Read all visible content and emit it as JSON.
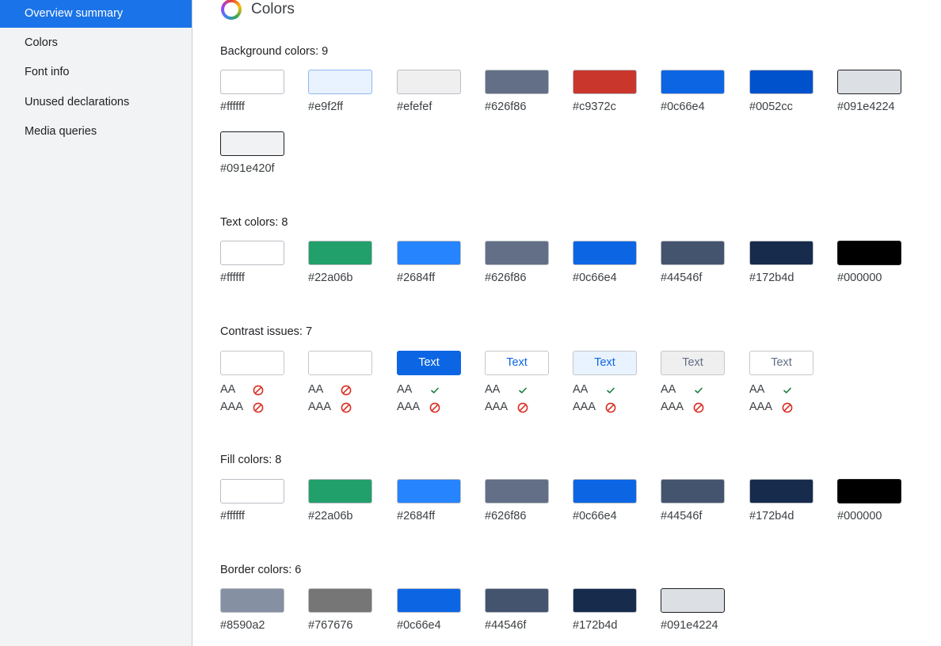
{
  "sidebar": {
    "items": [
      {
        "label": "Overview summary",
        "active": true
      },
      {
        "label": "Colors",
        "active": false
      },
      {
        "label": "Font info",
        "active": false
      },
      {
        "label": "Unused declarations",
        "active": false
      },
      {
        "label": "Media queries",
        "active": false
      }
    ]
  },
  "header": {
    "title": "Colors",
    "icon": "color-wheel-icon"
  },
  "background_colors": {
    "title": "Background colors: 9",
    "items": [
      "#ffffff",
      "#e9f2ff",
      "#efefef",
      "#626f86",
      "#c9372c",
      "#0c66e4",
      "#0052cc",
      "#091e4224",
      "#091e420f"
    ]
  },
  "text_colors": {
    "title": "Text colors: 8",
    "items": [
      "#ffffff",
      "#22a06b",
      "#2684ff",
      "#626f86",
      "#0c66e4",
      "#44546f",
      "#172b4d",
      "#000000"
    ]
  },
  "contrast_issues": {
    "title": "Contrast issues: 7",
    "aa_label": "AA",
    "aaa_label": "AAA",
    "items": [
      {
        "text": "",
        "fg": "#ffffff",
        "bg": "#ffffff",
        "aa": false,
        "aaa": false
      },
      {
        "text": "",
        "fg": "#ffffff",
        "bg": "#ffffff",
        "aa": false,
        "aaa": false
      },
      {
        "text": "Text",
        "fg": "#ffffff",
        "bg": "#0c66e4",
        "aa": true,
        "aaa": false
      },
      {
        "text": "Text",
        "fg": "#0c66e4",
        "bg": "#ffffff",
        "aa": true,
        "aaa": false
      },
      {
        "text": "Text",
        "fg": "#0c66e4",
        "bg": "#e9f2ff",
        "aa": true,
        "aaa": false
      },
      {
        "text": "Text",
        "fg": "#626f86",
        "bg": "#efefef",
        "aa": true,
        "aaa": false
      },
      {
        "text": "Text",
        "fg": "#626f86",
        "bg": "#ffffff",
        "aa": true,
        "aaa": false
      }
    ]
  },
  "fill_colors": {
    "title": "Fill colors: 8",
    "items": [
      "#ffffff",
      "#22a06b",
      "#2684ff",
      "#626f86",
      "#0c66e4",
      "#44546f",
      "#172b4d",
      "#000000"
    ]
  },
  "border_colors": {
    "title": "Border colors: 6",
    "items": [
      "#8590a2",
      "#767676",
      "#0c66e4",
      "#44546f",
      "#172b4d",
      "#091e4224"
    ]
  },
  "display_colors": {
    "#091e4224": "#dcdfe4",
    "#091e420f": "#f1f2f4"
  }
}
